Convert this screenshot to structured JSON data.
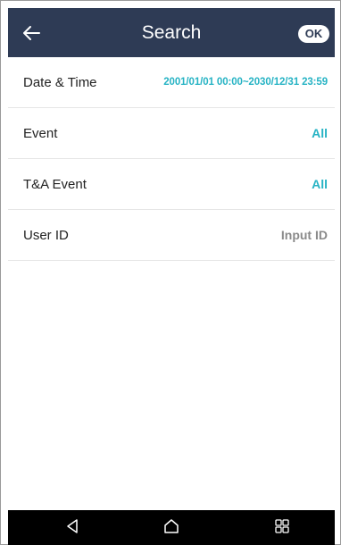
{
  "header": {
    "title": "Search",
    "back_icon": "arrow-left-icon",
    "ok_label": "OK"
  },
  "rows": [
    {
      "label": "Date & Time",
      "value": "2001/01/01 00:00~2030/12/31 23:59"
    },
    {
      "label": "Event",
      "value": "All"
    },
    {
      "label": "T&A Event",
      "value": "All"
    },
    {
      "label": "User ID",
      "value": "Input ID"
    }
  ],
  "navbar": {
    "icons": [
      "back-triangle-icon",
      "home-icon",
      "recent-apps-icon"
    ]
  },
  "colors": {
    "header_bg": "#2e3b55",
    "accent": "#26b3c4",
    "placeholder": "#8a8a8a",
    "navbar_bg": "#000000"
  }
}
